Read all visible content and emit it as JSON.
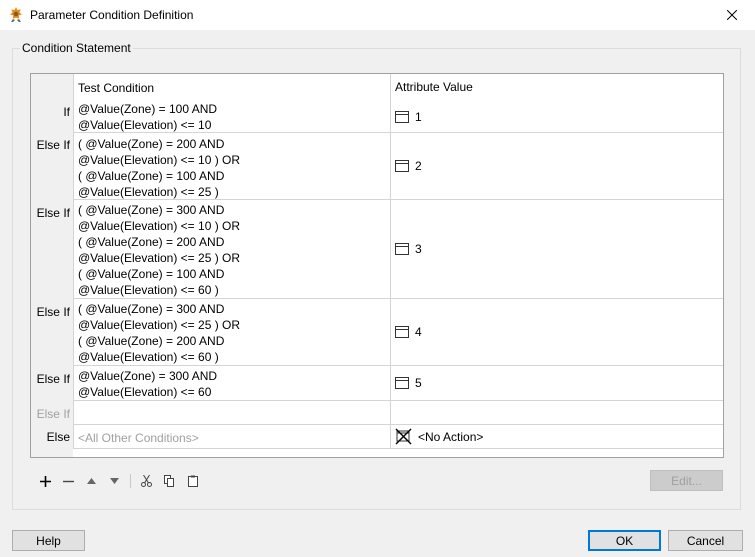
{
  "window": {
    "title": "Parameter Condition Definition"
  },
  "group": {
    "label": "Condition Statement"
  },
  "grid": {
    "headers": {
      "condition": "Test Condition",
      "value": "Attribute Value"
    },
    "rows": [
      {
        "label": "If",
        "lines": [
          "@Value(Zone) = 100 AND",
          "@Value(Elevation) <= 10"
        ],
        "value": "1"
      },
      {
        "label": "Else If",
        "lines": [
          "( @Value(Zone) = 200 AND",
          "@Value(Elevation) <= 10 ) OR",
          "( @Value(Zone) = 100 AND",
          "@Value(Elevation) <= 25 )"
        ],
        "value": "2"
      },
      {
        "label": "Else If",
        "lines": [
          "( @Value(Zone) = 300 AND",
          "@Value(Elevation) <= 10 ) OR",
          "( @Value(Zone) = 200 AND",
          "@Value(Elevation) <= 25 ) OR",
          "( @Value(Zone) = 100 AND",
          "@Value(Elevation) <= 60 )"
        ],
        "value": "3"
      },
      {
        "label": "Else If",
        "lines": [
          "( @Value(Zone) = 300 AND",
          "@Value(Elevation) <= 25 ) OR",
          "( @Value(Zone) = 200 AND",
          "@Value(Elevation) <= 60 )"
        ],
        "value": "4"
      },
      {
        "label": "Else If",
        "lines": [
          "@Value(Zone) = 300 AND",
          "@Value(Elevation) <= 60"
        ],
        "value": "5"
      }
    ],
    "empty_row_label": "Else If",
    "else_row": {
      "label": "Else",
      "placeholder": "<All Other Conditions>",
      "value": "<No Action>"
    }
  },
  "buttons": {
    "edit": "Edit...",
    "help": "Help",
    "ok": "OK",
    "cancel": "Cancel"
  },
  "icons": {
    "add": "plus-icon",
    "remove": "minus-icon",
    "up": "triangle-up-icon",
    "down": "triangle-down-icon",
    "cut": "scissors-icon",
    "copy": "copy-icon",
    "paste": "clipboard-icon",
    "value": "attribute-value-icon",
    "no_action": "no-action-icon"
  },
  "colors": {
    "accent": "#0078d7",
    "disabled_text": "#a0a0a0"
  }
}
